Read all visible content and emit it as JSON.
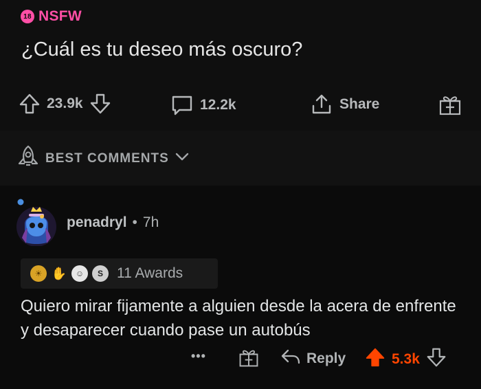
{
  "post": {
    "nsfw_badge_number": "18",
    "nsfw_label": "NSFW",
    "title": "¿Cuál es tu deseo más oscuro?",
    "upvotes": "23.9k",
    "comments": "12.2k",
    "share_label": "Share"
  },
  "sort": {
    "label": "BEST COMMENTS"
  },
  "comment": {
    "author": "penadryl",
    "separator": "•",
    "age": "7h",
    "awards_label": "11 Awards",
    "body": "Quiero mirar fijamente a alguien desde la acera de enfrente y desaparecer cuando pase un autobús",
    "more": "•••",
    "reply_label": "Reply",
    "score": "5.3k"
  },
  "colors": {
    "nsfw": "#ff4fa6",
    "upvote_active": "#ff4500",
    "background": "#0b0b0b",
    "text": "#e3e5e6"
  },
  "icons": [
    "upvote-icon",
    "downvote-icon",
    "comment-icon",
    "share-icon",
    "gift-icon",
    "rocket-icon",
    "chevron-down-icon",
    "reply-icon"
  ]
}
